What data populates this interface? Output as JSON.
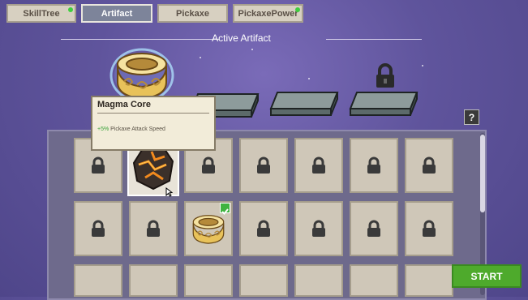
{
  "tabs": [
    {
      "label": "SkillTree",
      "active": false,
      "notification": true
    },
    {
      "label": "Artifact",
      "active": true,
      "notification": false
    },
    {
      "label": "Pickaxe",
      "active": false,
      "notification": false
    },
    {
      "label": "PickaxePower",
      "active": false,
      "notification": true
    }
  ],
  "section_title": "Active Artifact",
  "active_slots": [
    {
      "item": "golden-ring",
      "locked": false
    },
    {
      "item": "empty",
      "locked": false
    },
    {
      "item": "empty",
      "locked": false
    },
    {
      "item": "empty",
      "locked": true
    }
  ],
  "tooltip": {
    "name": "Magma Core",
    "bonus": "+5%",
    "effect": "Pickaxe Attack Speed"
  },
  "help_label": "?",
  "start_label": "START",
  "grid": {
    "row1": [
      "locked",
      "magma-core",
      "locked",
      "locked",
      "locked",
      "locked",
      "locked"
    ],
    "row2": [
      "locked",
      "locked",
      "golden-ring-equipped",
      "locked",
      "locked",
      "locked",
      "locked"
    ]
  },
  "colors": {
    "accent": "#4eaa2c",
    "notification": "#3fcf3f"
  }
}
